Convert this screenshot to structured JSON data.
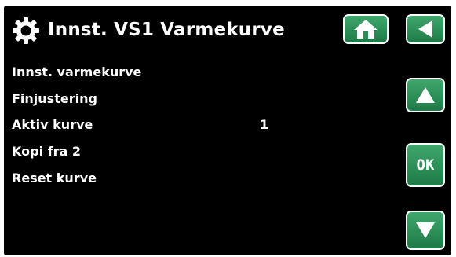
{
  "header": {
    "title": "Innst. VS1 Varmekurve",
    "icon": "gear-icon"
  },
  "nav": {
    "home_icon": "home-icon",
    "back_icon": "back-arrow-icon",
    "up_icon": "up-arrow-icon",
    "ok_label": "OK",
    "down_icon": "down-arrow-icon"
  },
  "menu": {
    "items": [
      {
        "label": "Innst. varmekurve"
      },
      {
        "label": "Finjustering"
      },
      {
        "label": "Aktiv kurve",
        "value": "1"
      },
      {
        "label": "Kopi fra 2"
      },
      {
        "label": "Reset kurve"
      }
    ]
  },
  "colors": {
    "background": "#000000",
    "button_green": "#2a8f57",
    "text": "#ffffff"
  }
}
